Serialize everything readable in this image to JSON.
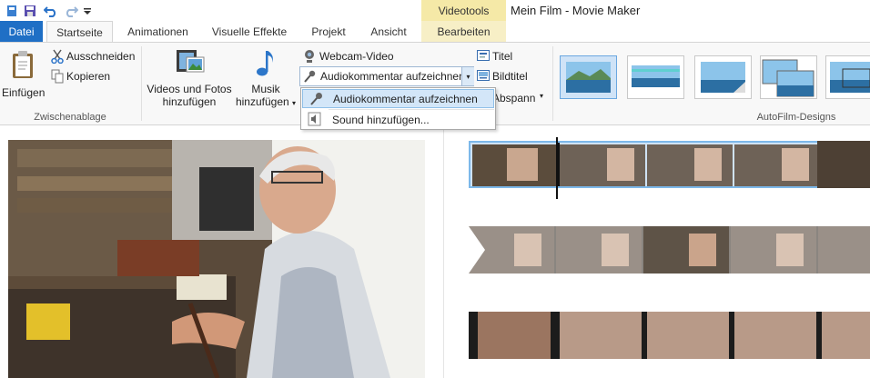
{
  "window": {
    "title": "Mein Film - Movie Maker",
    "contextual_tab_group": "Videotools"
  },
  "tabs": [
    {
      "label": "Datei"
    },
    {
      "label": "Startseite"
    },
    {
      "label": "Animationen"
    },
    {
      "label": "Visuelle Effekte"
    },
    {
      "label": "Projekt"
    },
    {
      "label": "Ansicht"
    },
    {
      "label": "Bearbeiten"
    }
  ],
  "ribbon": {
    "clipboard": {
      "paste": "Einfügen",
      "cut": "Ausschneiden",
      "copy": "Kopieren",
      "group_label": "Zwischenablage"
    },
    "add": {
      "videos_photos_line1": "Videos und Fotos",
      "videos_photos_line2": "hinzufügen",
      "music_line1": "Musik",
      "music_line2": "hinzufügen",
      "webcam": "Webcam-Video",
      "narration": "Audiokommentar aufzeichnen",
      "title": "Titel",
      "caption": "Bildtitel",
      "credits": "Abspann"
    },
    "autofilm": {
      "group_label": "AutoFilm-Designs"
    }
  },
  "dropdown": {
    "items": [
      {
        "label": "Audiokommentar aufzeichnen"
      },
      {
        "label": "Sound hinzufügen..."
      }
    ]
  },
  "colors": {
    "file_tab": "#1f6fc5",
    "contextual": "#f5e9a7",
    "selection": "#6aa7e0"
  },
  "icons": [
    "save-icon",
    "undo-icon",
    "redo-icon",
    "customize-icon",
    "paste-icon",
    "scissors-icon",
    "copy-icon",
    "film-icon",
    "music-note-icon",
    "webcam-icon",
    "microphone-icon",
    "title-icon",
    "caption-icon",
    "speaker-icon"
  ]
}
